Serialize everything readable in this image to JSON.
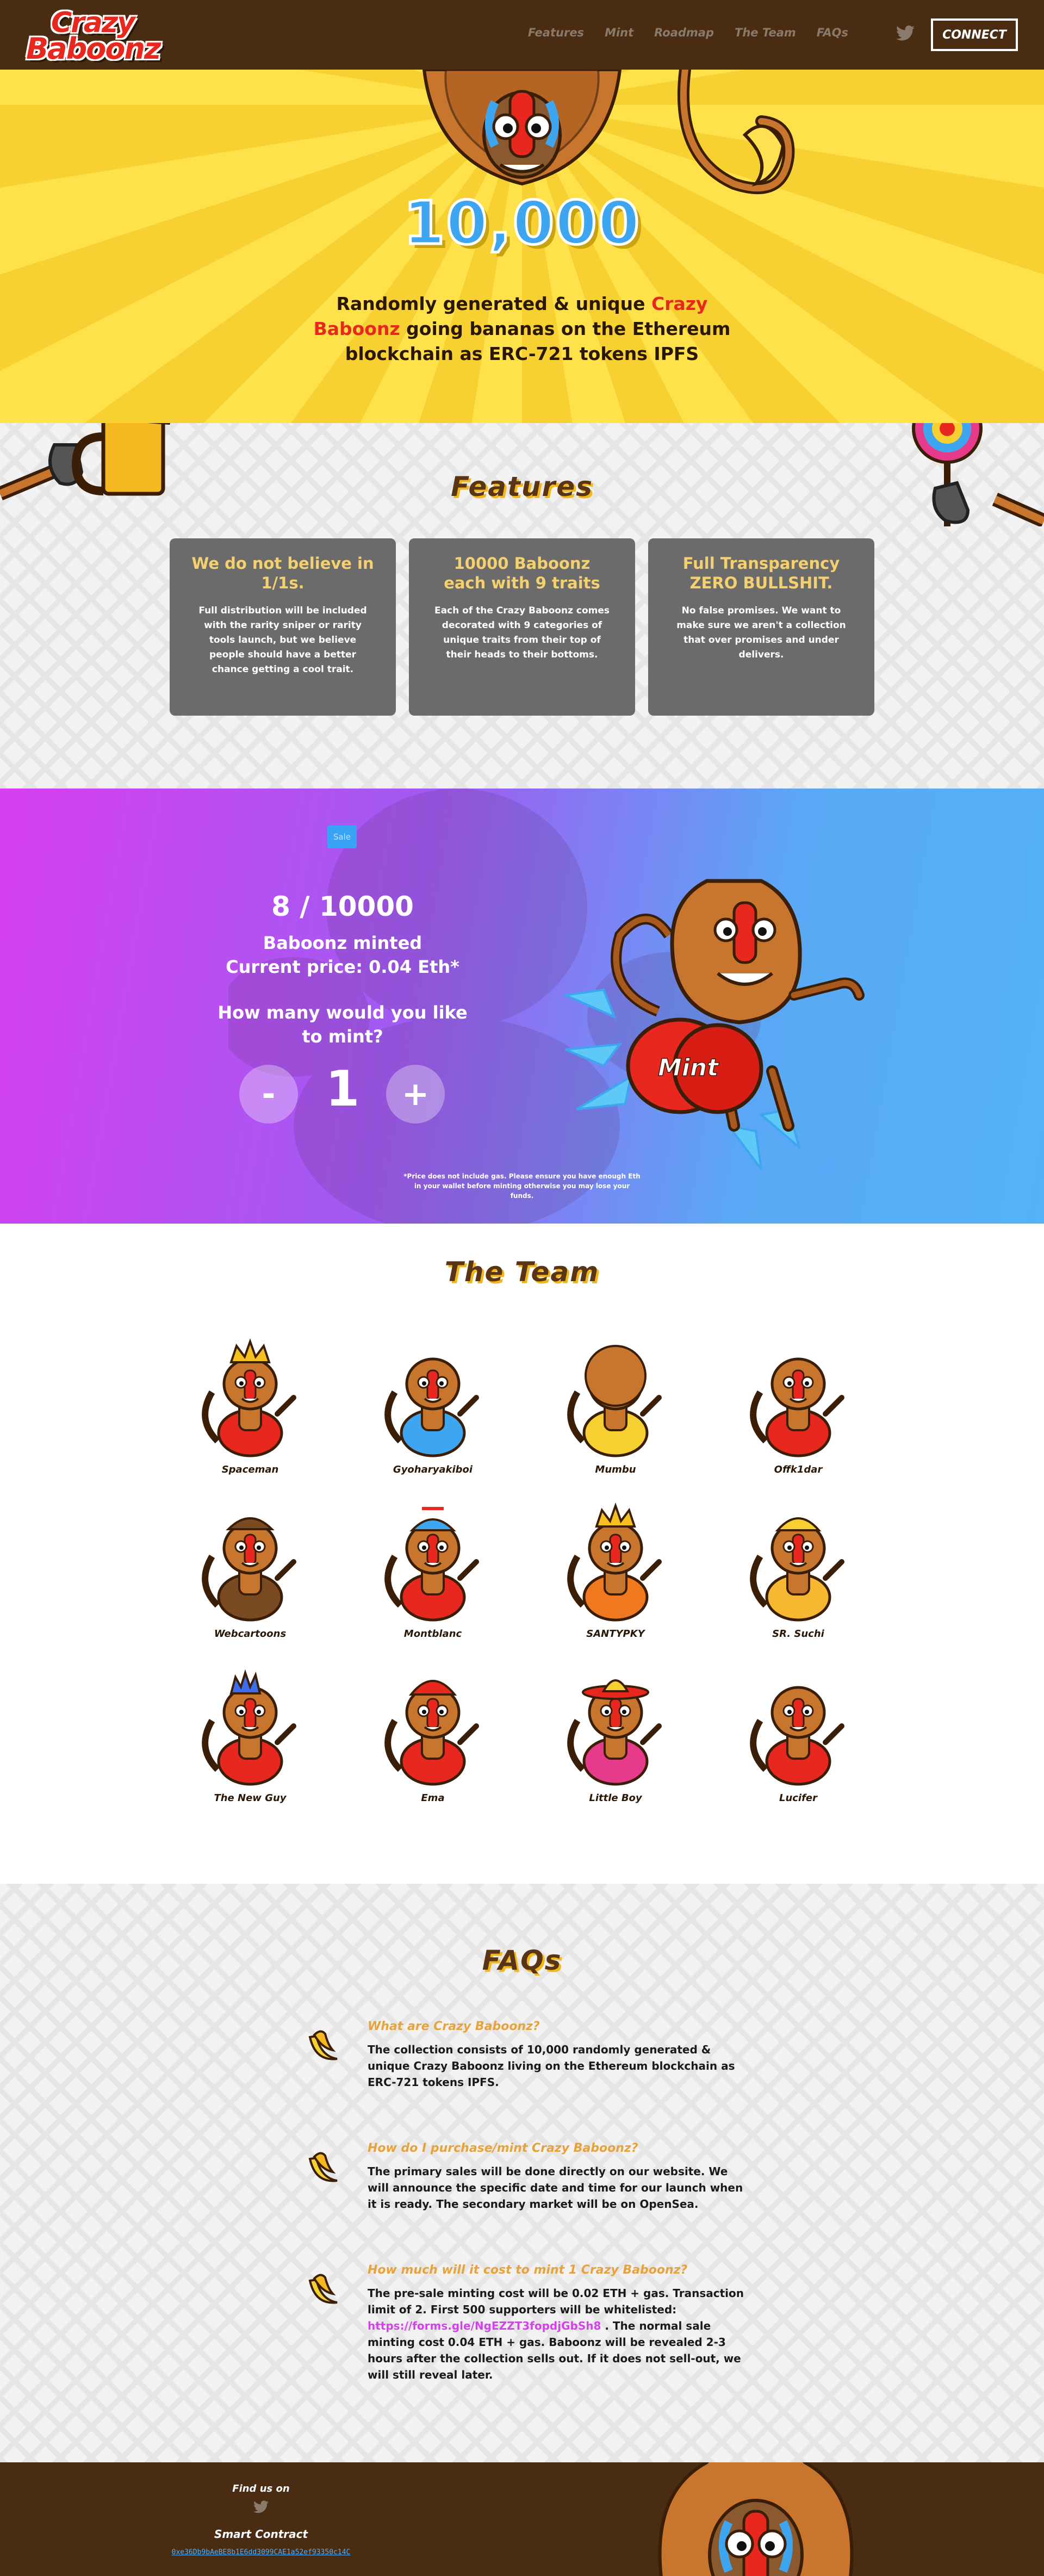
{
  "nav": {
    "logo_line1": "Crazy",
    "logo_line2": "Baboonz",
    "links": [
      "Features",
      "Mint",
      "Roadmap",
      "The Team",
      "FAQs"
    ],
    "connect_label": "Connect"
  },
  "hero": {
    "count": "10,000",
    "tagline_pre": "Randomly generated & unique ",
    "tagline_highlight": "Crazy Baboonz",
    "tagline_post": " going bananas on the Ethereum blockchain as ERC-721 tokens IPFS"
  },
  "features": {
    "title": "Features",
    "cards": [
      {
        "title": "We do not believe in 1/1s.",
        "body": "Full distribution will be included with the rarity sniper or rarity tools launch, but we believe people should have a better chance getting a cool trait."
      },
      {
        "title": "10000 Baboonz each with 9 traits",
        "body": "Each of the Crazy Baboonz comes decorated with 9 categories of unique traits from their top of their heads to their bottoms."
      },
      {
        "title": "Full Transparency ZERO BULLSHIT.",
        "body": "No false promises. We want to make sure we aren't a collection that over promises and under delivers."
      }
    ]
  },
  "mint": {
    "badge": "Sale",
    "count": "8 / 10000",
    "minted_label": "Baboonz minted",
    "price_label": "Current price: 0.04 Eth*",
    "question": "How many would you like to mint?",
    "minus": "-",
    "quantity": "1",
    "plus": "+",
    "mint_label": "Mint",
    "note": "*Price does not include gas. Please ensure you have enough Eth in your wallet before minting otherwise you may lose your funds."
  },
  "team": {
    "title": "The Team",
    "members": [
      {
        "name": "Spaceman",
        "hat": "crown",
        "body": "#e8281e"
      },
      {
        "name": "Gyoharyakiboi",
        "hat": "none",
        "body": "#3ea6f0"
      },
      {
        "name": "Mumbu",
        "hat": "mane",
        "body": "#f5d030"
      },
      {
        "name": "Offk1dar",
        "hat": "none",
        "body": "#e8281e"
      },
      {
        "name": "Webcartoons",
        "hat": "cap",
        "body": "#7a4a22"
      },
      {
        "name": "Montblanc",
        "hat": "propeller",
        "body": "#e8281e"
      },
      {
        "name": "SANTYPKY",
        "hat": "crown",
        "body": "#f0781e"
      },
      {
        "name": "SR. Suchi",
        "hat": "helmet",
        "body": "#f5b830"
      },
      {
        "name": "The New Guy",
        "hat": "spiky",
        "body": "#e8281e"
      },
      {
        "name": "Ema",
        "hat": "firehat",
        "body": "#e8281e"
      },
      {
        "name": "Little Boy",
        "hat": "sombrero",
        "body": "#e83a8a"
      },
      {
        "name": "Lucifer",
        "hat": "none",
        "body": "#e8281e"
      }
    ]
  },
  "faq": {
    "title": "FAQs",
    "items": [
      {
        "q": "What are Crazy Baboonz?",
        "a": "The collection consists of 10,000 randomly generated & unique Crazy Baboonz living on the Ethereum blockchain as ERC-721 tokens IPFS."
      },
      {
        "q": "How do I purchase/mint Crazy Baboonz?",
        "a": "The primary sales will be done directly on our website. We will announce the specific date and time for our launch when it is ready. The secondary market will be on OpenSea."
      },
      {
        "q": "How much will it cost to mint 1 Crazy Baboonz?",
        "a_pre": "The pre-sale minting cost will be 0.02 ETH + gas. Transaction limit of 2. First 500 supporters will be whitelisted:",
        "a_link": "https://forms.gle/NgEZZT3fopdjGbSh8",
        "a_post": ". The normal sale minting cost 0.04 ETH + gas. Baboonz will be revealed 2-3 hours after the collection sells out. If it does not sell-out, we will still reveal later."
      }
    ]
  },
  "footer": {
    "find_us": "Find us on",
    "smart_contract": "Smart Contract",
    "address": "0xe36Db9bAeBE8b1E6dd3099CAE1a52ef93350c14C"
  },
  "colors": {
    "brown": "#4a2c13",
    "yellow": "#ffe24a",
    "red": "#e8281e",
    "blue": "#3ea6f0",
    "card_gray": "#6b6b6b",
    "purple": "#d83ff0"
  }
}
